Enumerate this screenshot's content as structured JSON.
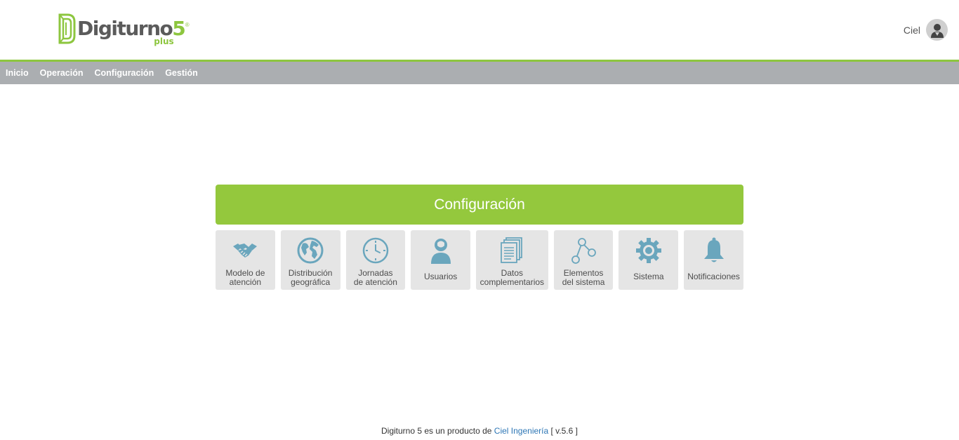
{
  "header": {
    "logo": {
      "word": "Digiturno",
      "number": "5",
      "registered": "®",
      "sub": "plus"
    },
    "user": {
      "name": "Ciel"
    }
  },
  "nav": {
    "items": [
      {
        "label": "Inicio"
      },
      {
        "label": "Operación"
      },
      {
        "label": "Configuración"
      },
      {
        "label": "Gestión"
      }
    ]
  },
  "main": {
    "title": "Configuración",
    "tiles": [
      {
        "line1": "Modelo de",
        "line2": "atención",
        "icon": "handshake-icon"
      },
      {
        "line1": "Distribución",
        "line2": "geográfica",
        "icon": "globe-icon"
      },
      {
        "line1": "Jornadas",
        "line2": "de atención",
        "icon": "clock-icon"
      },
      {
        "line1": "Usuarios",
        "line2": "",
        "icon": "user-icon"
      },
      {
        "line1": "Datos",
        "line2": "complementarios",
        "icon": "documents-icon"
      },
      {
        "line1": "Elementos",
        "line2": "del sistema",
        "icon": "nodes-icon"
      },
      {
        "line1": "Sistema",
        "line2": "",
        "icon": "gear-icon"
      },
      {
        "line1": "Notificaciones",
        "line2": "",
        "icon": "bell-icon"
      }
    ]
  },
  "footer": {
    "prefix": "Digiturno 5 es un producto de",
    "link": "Ciel Ingeniería",
    "version": "[ v.5.6 ]"
  },
  "colors": {
    "accent": "#94c83d",
    "nav_bg": "#abaeb1",
    "icon": "#6aa6bd",
    "tile_bg": "#e5e5e5",
    "link": "#2d76b5"
  }
}
